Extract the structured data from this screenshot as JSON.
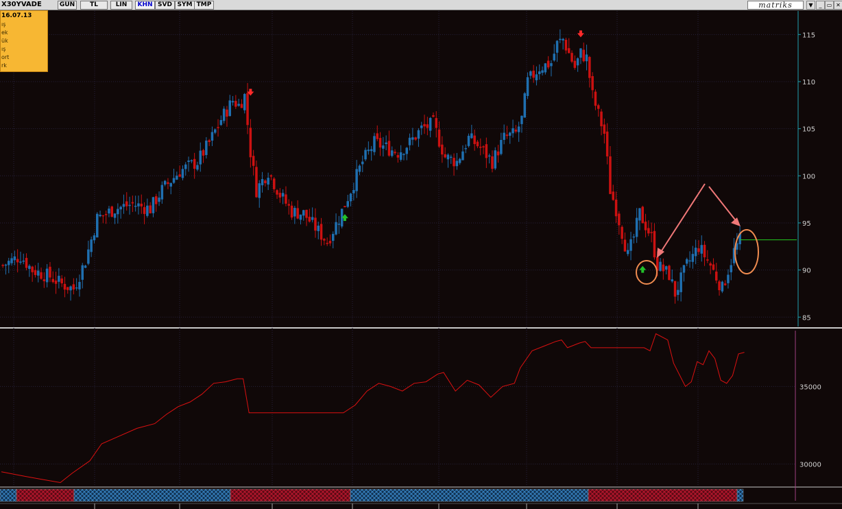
{
  "toolbar": {
    "symbol": "X30YVADE",
    "buttons": [
      "GUN",
      "TL",
      "LIN",
      "KHN",
      "SVD",
      "SYM",
      "TMP"
    ],
    "active": "KHN",
    "brand": "matriks"
  },
  "info_box": {
    "date": "16.07.13",
    "rows": [
      "ış",
      "ek",
      "ük",
      "ış",
      "ort",
      "rk"
    ]
  },
  "colors": {
    "up": "#1f6fb0",
    "down": "#cc1111",
    "indicator": "#dd1111",
    "annotation": "#f08c50",
    "arrow": "#f07878",
    "last_price_line": "#22cc22"
  },
  "chart_data": [
    {
      "type": "candlestick",
      "ylim": [
        84,
        117.5
      ],
      "ytick_labels": [
        "85",
        "90",
        "95",
        "100",
        "105",
        "110",
        "115"
      ],
      "x_count": 180,
      "last_price": 93.2,
      "close_path": [
        [
          0,
          90.5
        ],
        [
          6,
          91.5
        ],
        [
          10,
          90.0
        ],
        [
          16,
          89.3
        ],
        [
          20,
          88.5
        ],
        [
          24,
          88.0
        ],
        [
          28,
          91.0
        ],
        [
          32,
          95.5
        ],
        [
          38,
          96.5
        ],
        [
          44,
          97.0
        ],
        [
          50,
          96.5
        ],
        [
          54,
          98.5
        ],
        [
          60,
          100.5
        ],
        [
          66,
          101.5
        ],
        [
          70,
          103.5
        ],
        [
          74,
          106.0
        ],
        [
          78,
          108.0
        ],
        [
          80,
          107.5
        ],
        [
          82,
          108.5
        ],
        [
          84,
          102.5
        ],
        [
          86,
          98.5
        ],
        [
          90,
          100.5
        ],
        [
          94,
          98.0
        ],
        [
          98,
          96.2
        ],
        [
          102,
          96.0
        ],
        [
          106,
          94.5
        ],
        [
          110,
          93.0
        ],
        [
          114,
          95.5
        ],
        [
          118,
          98.5
        ],
        [
          122,
          101.5
        ],
        [
          126,
          103.5
        ],
        [
          130,
          103.0
        ],
        [
          134,
          102.5
        ],
        [
          138,
          103.5
        ],
        [
          142,
          105.0
        ],
        [
          146,
          105.5
        ],
        [
          150,
          102.0
        ],
        [
          154,
          101.5
        ],
        [
          158,
          104.0
        ],
        [
          162,
          103.0
        ],
        [
          166,
          101.5
        ],
        [
          170,
          104.0
        ],
        [
          174,
          104.5
        ],
        [
          176,
          106.0
        ],
        [
          178,
          110.0
        ],
        [
          182,
          111.5
        ],
        [
          186,
          112.0
        ],
        [
          188,
          114.0
        ],
        [
          190,
          114.5
        ],
        [
          192,
          113.0
        ],
        [
          194,
          111.5
        ],
        [
          196,
          113.0
        ],
        [
          198,
          112.5
        ],
        [
          200,
          108.5
        ],
        [
          204,
          104.5
        ],
        [
          206,
          98.5
        ],
        [
          208,
          96.5
        ],
        [
          212,
          91.5
        ],
        [
          214,
          93.5
        ],
        [
          216,
          96.0
        ],
        [
          220,
          93.5
        ],
        [
          222,
          90.5
        ],
        [
          226,
          89.5
        ],
        [
          228,
          87.5
        ],
        [
          232,
          90.5
        ],
        [
          236,
          92.5
        ],
        [
          240,
          90.5
        ],
        [
          244,
          88.0
        ],
        [
          246,
          90.0
        ],
        [
          248,
          92.0
        ],
        [
          250,
          93.2
        ]
      ],
      "signals": [
        {
          "type": "sell",
          "i": 84,
          "y": 108.8
        },
        {
          "type": "buy",
          "i": 116,
          "y": 95.5
        },
        {
          "type": "sell",
          "i": 196,
          "y": 115.0
        },
        {
          "type": "buy",
          "i": 217,
          "y": 90.0
        }
      ]
    },
    {
      "type": "line",
      "ylim": [
        28600,
        38600
      ],
      "ytick_labels": [
        "30000",
        "35000"
      ],
      "values": [
        [
          0,
          29500
        ],
        [
          8,
          29200
        ],
        [
          14,
          29000
        ],
        [
          20,
          28800
        ],
        [
          24,
          29400
        ],
        [
          30,
          30200
        ],
        [
          34,
          31300
        ],
        [
          40,
          31800
        ],
        [
          46,
          32300
        ],
        [
          52,
          32600
        ],
        [
          56,
          33200
        ],
        [
          60,
          33700
        ],
        [
          64,
          34000
        ],
        [
          68,
          34500
        ],
        [
          72,
          35200
        ],
        [
          76,
          35300
        ],
        [
          80,
          35500
        ],
        [
          82,
          35500
        ],
        [
          84,
          33300
        ],
        [
          116,
          33300
        ],
        [
          120,
          33800
        ],
        [
          124,
          34700
        ],
        [
          128,
          35200
        ],
        [
          132,
          35000
        ],
        [
          136,
          34700
        ],
        [
          140,
          35200
        ],
        [
          144,
          35300
        ],
        [
          148,
          35800
        ],
        [
          150,
          35900
        ],
        [
          154,
          34700
        ],
        [
          158,
          35400
        ],
        [
          162,
          35100
        ],
        [
          166,
          34300
        ],
        [
          170,
          35000
        ],
        [
          174,
          35200
        ],
        [
          176,
          36200
        ],
        [
          180,
          37300
        ],
        [
          184,
          37600
        ],
        [
          188,
          37900
        ],
        [
          190,
          38000
        ],
        [
          192,
          37500
        ],
        [
          196,
          37800
        ],
        [
          198,
          37900
        ],
        [
          200,
          37500
        ],
        [
          218,
          37500
        ],
        [
          220,
          37300
        ],
        [
          222,
          38400
        ],
        [
          226,
          38000
        ],
        [
          228,
          36500
        ],
        [
          232,
          35000
        ],
        [
          234,
          35300
        ],
        [
          236,
          36600
        ],
        [
          238,
          36400
        ],
        [
          240,
          37300
        ],
        [
          242,
          36800
        ],
        [
          244,
          35400
        ],
        [
          246,
          35200
        ],
        [
          248,
          35700
        ],
        [
          250,
          37100
        ],
        [
          252,
          37200
        ]
      ]
    }
  ]
}
